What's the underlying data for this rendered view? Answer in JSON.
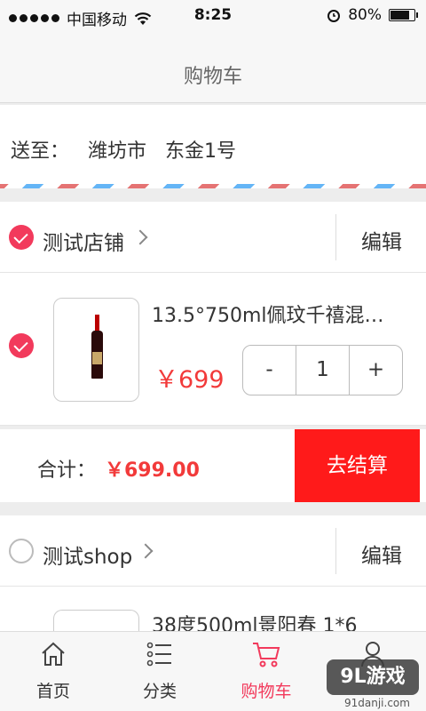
{
  "status_bar": {
    "carrier": "中国移动",
    "time": "8:25",
    "battery": "80%"
  },
  "header": {
    "title": "购物车"
  },
  "address": {
    "label": "送至：",
    "city": "潍坊市",
    "street": "东金1号"
  },
  "stores": [
    {
      "name": "测试店铺",
      "edit_label": "编辑",
      "selected": true,
      "product": {
        "name": "13.5°750ml佩玟千禧混…",
        "price": "￥699",
        "quantity": "1",
        "minus": "-",
        "plus": "+"
      },
      "total_label": "合计：",
      "total_amount": "￥699.00",
      "checkout_label": "去结算"
    },
    {
      "name": "测试shop",
      "edit_label": "编辑",
      "selected": false,
      "product": {
        "name": "38度500ml景阳春 1*6"
      }
    }
  ],
  "tabs": [
    {
      "label": "首页",
      "icon": "home-icon"
    },
    {
      "label": "分类",
      "icon": "list-icon"
    },
    {
      "label": "购物车",
      "icon": "cart-icon",
      "active": true
    },
    {
      "label": "",
      "icon": "user-icon"
    }
  ],
  "watermark": {
    "brand": "9L游戏",
    "site": "91danji.com"
  },
  "colors": {
    "accent": "#f23a5c",
    "checkout": "#ff1a1a",
    "price": "#f23a3a"
  }
}
